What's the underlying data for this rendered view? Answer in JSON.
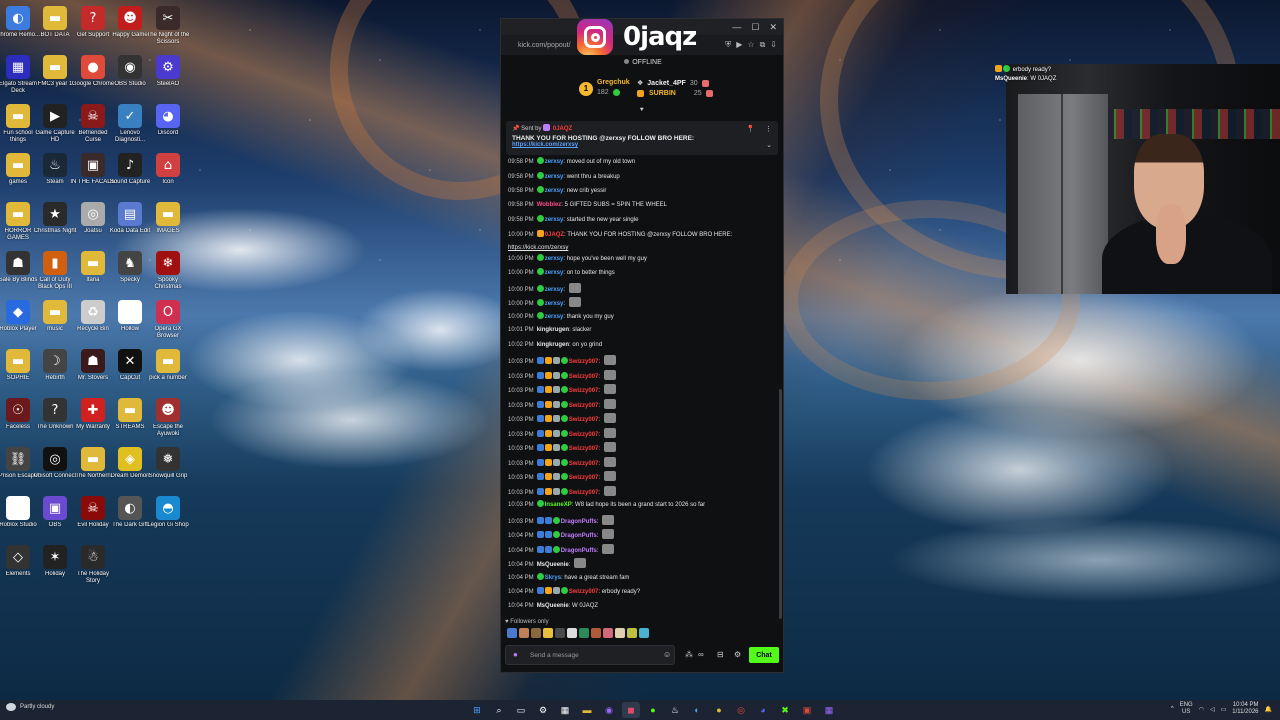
{
  "desktop_icons": [
    {
      "label": "Chrome Remo...",
      "color": "#3c7be0",
      "glyph": "◐"
    },
    {
      "label": "BOT DATA",
      "color": "#e0b83a",
      "glyph": "▬"
    },
    {
      "label": "Get Support",
      "color": "#c42a2a",
      "glyph": "?"
    },
    {
      "label": "Happy Game",
      "color": "#c21d1d",
      "glyph": "☻"
    },
    {
      "label": "The Night of the Scissors",
      "color": "#3a2a2a",
      "glyph": "✂"
    },
    {
      "label": "Elgato Stream Deck",
      "color": "#2c2cbd",
      "glyph": "▦"
    },
    {
      "label": "FMC3 year 1",
      "color": "#e0b83a",
      "glyph": "▬"
    },
    {
      "label": "Google Chrome",
      "color": "#e04a3a",
      "glyph": "●"
    },
    {
      "label": "OBS Studio",
      "color": "#333",
      "glyph": "◉"
    },
    {
      "label": "SteelAO",
      "color": "#4a3ad0",
      "glyph": "⚙"
    },
    {
      "label": "Fun school things",
      "color": "#e0b83a",
      "glyph": "▬"
    },
    {
      "label": "Game Capture HD",
      "color": "#222",
      "glyph": "▶"
    },
    {
      "label": "Befriended Curse",
      "color": "#8a1a1a",
      "glyph": "☠"
    },
    {
      "label": "Lenovo Diagnosti...",
      "color": "#3a80c0",
      "glyph": "✓"
    },
    {
      "label": "Discord",
      "color": "#5865f2",
      "glyph": "◕"
    },
    {
      "label": "games",
      "color": "#e0b83a",
      "glyph": "▬"
    },
    {
      "label": "Steam",
      "color": "#1b2838",
      "glyph": "♨"
    },
    {
      "label": "IN THE FACADE",
      "color": "#3a2a2a",
      "glyph": "▣"
    },
    {
      "label": "Sound Capture",
      "color": "#222",
      "glyph": "♪"
    },
    {
      "label": "Icon",
      "color": "#d04040",
      "glyph": "⌂"
    },
    {
      "label": "HORROR GAMES",
      "color": "#e0b83a",
      "glyph": "▬"
    },
    {
      "label": "Christmas Night",
      "color": "#2a2a2a",
      "glyph": "★"
    },
    {
      "label": "Joatsu",
      "color": "#aaa",
      "glyph": "◎"
    },
    {
      "label": "Koda Data Edit",
      "color": "#5a7ad0",
      "glyph": "▤"
    },
    {
      "label": "IMAGES",
      "color": "#e0b83a",
      "glyph": "▬"
    },
    {
      "label": "Sale By Blinds",
      "color": "#333",
      "glyph": "☗"
    },
    {
      "label": "Call of Duty Black Ops III",
      "color": "#d06010",
      "glyph": "▮"
    },
    {
      "label": "ltaria",
      "color": "#e0b83a",
      "glyph": "▬"
    },
    {
      "label": "Specky",
      "color": "#444",
      "glyph": "♞"
    },
    {
      "label": "Spooky Christmas",
      "color": "#a01010",
      "glyph": "❄"
    },
    {
      "label": "Roblox Player",
      "color": "#2a6ae0",
      "glyph": "◆"
    },
    {
      "label": "music",
      "color": "#e0b83a",
      "glyph": "▬"
    },
    {
      "label": "Recycle Bin",
      "color": "#ccc",
      "glyph": "♻"
    },
    {
      "label": "Hollow",
      "color": "#fff",
      "glyph": "◌"
    },
    {
      "label": "Opera GX Browser",
      "color": "#d03050",
      "glyph": "O"
    },
    {
      "label": "SOPHIE",
      "color": "#e0b83a",
      "glyph": "▬"
    },
    {
      "label": "Rebirth",
      "color": "#444",
      "glyph": "☽"
    },
    {
      "label": "Mr. Stovers",
      "color": "#3a1a1a",
      "glyph": "☗"
    },
    {
      "label": "CapCut",
      "color": "#111",
      "glyph": "✕"
    },
    {
      "label": "pick a number",
      "color": "#e0b83a",
      "glyph": "▬"
    },
    {
      "label": "Faceless",
      "color": "#6a1a1a",
      "glyph": "☉"
    },
    {
      "label": "The Unknown",
      "color": "#333",
      "glyph": "?"
    },
    {
      "label": "My Warranty",
      "color": "#d02020",
      "glyph": "✚"
    },
    {
      "label": "STREAMS",
      "color": "#e0b83a",
      "glyph": "▬"
    },
    {
      "label": "Escape the Ayuwoki",
      "color": "#a03030",
      "glyph": "☻"
    },
    {
      "label": "Prison Escape",
      "color": "#444",
      "glyph": "⛓"
    },
    {
      "label": "Ubisoft Connect",
      "color": "#111",
      "glyph": "◎"
    },
    {
      "label": "The Northern",
      "color": "#e0b83a",
      "glyph": "▬"
    },
    {
      "label": "Dream Demon",
      "color": "#e0c020",
      "glyph": "◈"
    },
    {
      "label": "Snowquill Grip",
      "color": "#333",
      "glyph": "❅"
    },
    {
      "label": "Roblox Studio",
      "color": "#fff",
      "glyph": "■"
    },
    {
      "label": "OBS",
      "color": "#6a4ad0",
      "glyph": "▣"
    },
    {
      "label": "Evil Holiday",
      "color": "#8a0a0a",
      "glyph": "☠"
    },
    {
      "label": "The Dark Gift",
      "color": "#555",
      "glyph": "◐"
    },
    {
      "label": "Legion Gi Shop",
      "color": "#1a8ad0",
      "glyph": "◓"
    },
    {
      "label": "Elements",
      "color": "#333",
      "glyph": "◇"
    },
    {
      "label": "Holiday",
      "color": "#222",
      "glyph": "✶"
    },
    {
      "label": "The Holiday Story",
      "color": "#2a2a2a",
      "glyph": "☃"
    }
  ],
  "chat_window": {
    "url": "kick.com/popout/",
    "overlay_name": "0jaqz",
    "status": "OFFLINE",
    "leaderboard": [
      {
        "name": "Gregchuk",
        "score": "182"
      },
      {
        "name": "Jacket_4PF",
        "score": "30"
      },
      {
        "name": "SURBIN",
        "score": "25"
      }
    ],
    "pinned": {
      "sent_by": "Sent by",
      "author": "0JAQZ",
      "text": "THANK YOU FOR HOSTING @zerxsy FOLLOW BRO HERE:",
      "link": "https://kick.com/zerxsy"
    },
    "messages": [
      {
        "time": "09:58 PM",
        "user": "zerxsy",
        "color": "#4aa3ff",
        "text": "moved out of my old town"
      },
      {
        "time": "09:58 PM",
        "user": "zerxsy",
        "color": "#4aa3ff",
        "text": "went thru a breakup"
      },
      {
        "time": "09:58 PM",
        "user": "zerxsy",
        "color": "#4aa3ff",
        "text": "new crib yessir"
      },
      {
        "time": "09:58 PM",
        "user": "Wobblez",
        "color": "#ff4a8a",
        "text": "5 GIFTED SUBS = SPIN THE WHEEL"
      },
      {
        "time": "09:58 PM",
        "user": "zerxsy",
        "color": "#4aa3ff",
        "text": "started the new year single"
      },
      {
        "time": "10:00 PM",
        "user": "0JAQZ",
        "color": "#ff3b3b",
        "text": "THANK YOU FOR HOSTING @zerxsy FOLLOW BRO HERE:"
      },
      {
        "time": "",
        "user": "",
        "color": "#fff",
        "text": "https://kick.com/zerxsy"
      },
      {
        "time": "10:00 PM",
        "user": "zerxsy",
        "color": "#4aa3ff",
        "text": "hope you've been well my guy"
      },
      {
        "time": "10:00 PM",
        "user": "zerxsy",
        "color": "#4aa3ff",
        "text": "on to better things"
      },
      {
        "time": "10:00 PM",
        "user": "zerxsy",
        "color": "#4aa3ff",
        "text": ""
      },
      {
        "time": "10:00 PM",
        "user": "zerxsy",
        "color": "#4aa3ff",
        "text": ""
      },
      {
        "time": "10:00 PM",
        "user": "zerxsy",
        "color": "#4aa3ff",
        "text": "thank you my guy"
      },
      {
        "time": "10:01 PM",
        "user": "kingkrugen",
        "color": "#e8e8e8",
        "text": "slacker"
      },
      {
        "time": "10:02 PM",
        "user": "kingkrugen",
        "color": "#e8e8e8",
        "text": "on yo grind"
      },
      {
        "time": "10:03 PM",
        "user": "Swizzy007",
        "color": "#ff3b3b",
        "text": ""
      },
      {
        "time": "10:03 PM",
        "user": "Swizzy007",
        "color": "#ff3b3b",
        "text": ""
      },
      {
        "time": "10:03 PM",
        "user": "Swizzy007",
        "color": "#ff3b3b",
        "text": ""
      },
      {
        "time": "10:03 PM",
        "user": "Swizzy007",
        "color": "#ff3b3b",
        "text": ""
      },
      {
        "time": "10:03 PM",
        "user": "Swizzy007",
        "color": "#ff3b3b",
        "text": ""
      },
      {
        "time": "10:03 PM",
        "user": "Swizzy007",
        "color": "#ff3b3b",
        "text": ""
      },
      {
        "time": "10:03 PM",
        "user": "Swizzy007",
        "color": "#ff3b3b",
        "text": ""
      },
      {
        "time": "10:03 PM",
        "user": "Swizzy007",
        "color": "#ff3b3b",
        "text": ""
      },
      {
        "time": "10:03 PM",
        "user": "Swizzy007",
        "color": "#ff3b3b",
        "text": ""
      },
      {
        "time": "10:03 PM",
        "user": "Swizzy007",
        "color": "#ff3b3b",
        "text": ""
      },
      {
        "time": "10:03 PM",
        "user": "InsaneXP",
        "color": "#53fc18",
        "text": "W8 lad hope its been a grand start to 2026 so far"
      },
      {
        "time": "10:03 PM",
        "user": "DragonPuffs",
        "color": "#c07cff",
        "text": ""
      },
      {
        "time": "10:04 PM",
        "user": "DragonPuffs",
        "color": "#c07cff",
        "text": ""
      },
      {
        "time": "10:04 PM",
        "user": "DragonPuffs",
        "color": "#c07cff",
        "text": ""
      },
      {
        "time": "10:04 PM",
        "user": "MsQueenie",
        "color": "#e8e8e8",
        "text": ""
      },
      {
        "time": "10:04 PM",
        "user": "Skrys",
        "color": "#4aa3ff",
        "text": "have a great stream fam"
      },
      {
        "time": "10:04 PM",
        "user": "Swizzy007",
        "color": "#ff3b3b",
        "text": "erbody ready?"
      },
      {
        "time": "10:04 PM",
        "user": "MsQueenie",
        "color": "#e8e8e8",
        "text": "W 0JAQZ"
      }
    ],
    "followers_only": "Followers only",
    "input_placeholder": "Send a message",
    "chat_button": "Chat"
  },
  "overlay_chat": [
    {
      "user": "",
      "text": "erbody ready?"
    },
    {
      "user": "MsQueenie",
      "text": "W 0JAQZ"
    }
  ],
  "taskbar": {
    "weather": "Partly cloudy",
    "lang_top": "ENG",
    "lang_bottom": "US",
    "time": "10:04 PM",
    "date": "1/11/2026"
  }
}
